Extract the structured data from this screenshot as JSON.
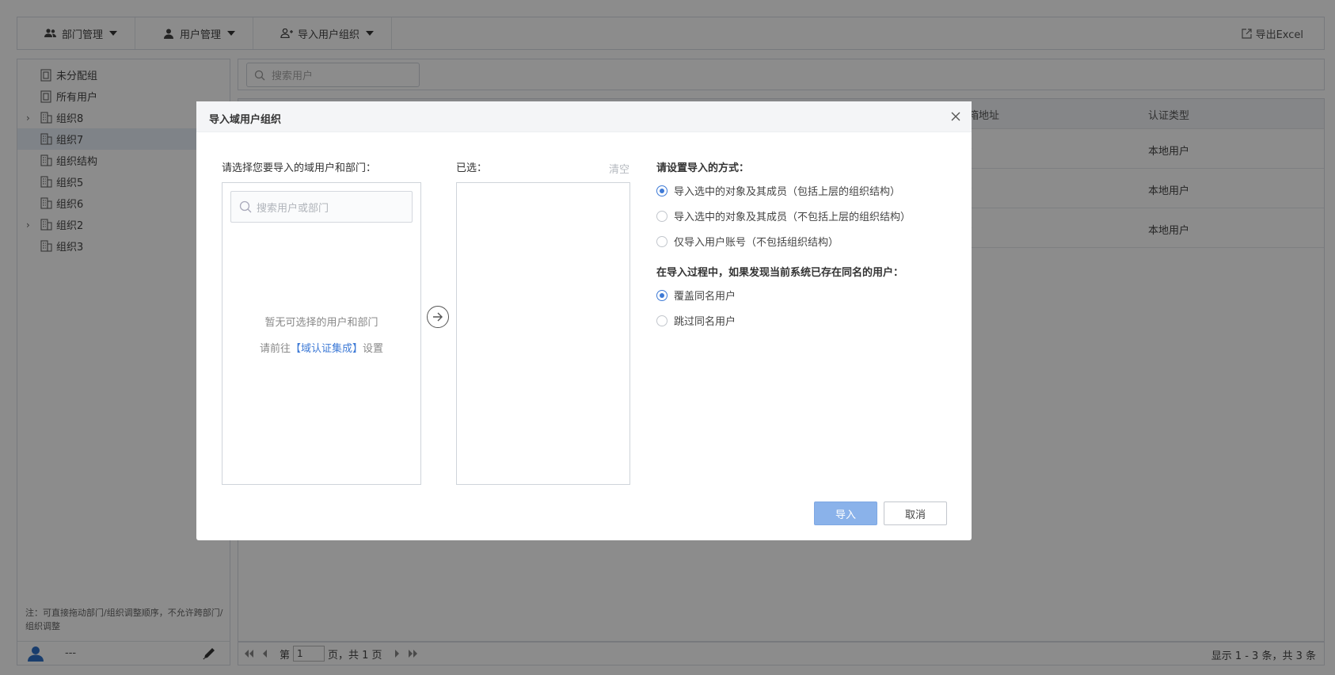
{
  "toolbar": {
    "dept_mgmt": "部门管理",
    "user_mgmt": "用户管理",
    "import_org": "导入用户组织",
    "export_excel": "导出Excel"
  },
  "tree": {
    "items": [
      {
        "label": "未分配组",
        "has_children": false,
        "icon": "doc-group-icon"
      },
      {
        "label": "所有用户",
        "has_children": false,
        "icon": "doc-group-icon"
      },
      {
        "label": "组织8",
        "has_children": true,
        "icon": "building-icon"
      },
      {
        "label": "组织7",
        "has_children": false,
        "icon": "building-icon",
        "active": true
      },
      {
        "label": "组织结构",
        "has_children": false,
        "icon": "building-icon"
      },
      {
        "label": "组织5",
        "has_children": false,
        "icon": "building-icon"
      },
      {
        "label": "组织6",
        "has_children": false,
        "icon": "building-icon"
      },
      {
        "label": "组织2",
        "has_children": true,
        "icon": "building-icon"
      },
      {
        "label": "组织3",
        "has_children": false,
        "icon": "building-icon"
      }
    ],
    "note": "注：可直接拖动部门/组织调整顺序，不允许跨部门/组织调整",
    "footer_user": "---"
  },
  "search": {
    "placeholder": "搜索用户"
  },
  "grid": {
    "columns": [
      "箱地址",
      "认证类型"
    ],
    "rows": [
      {
        "mail": "-",
        "auth": "本地用户"
      },
      {
        "mail": "-",
        "auth": "本地用户"
      },
      {
        "mail": "-",
        "auth": "本地用户"
      }
    ]
  },
  "pager": {
    "prefix": "第",
    "page": "1",
    "suffix": "页，共 1 页",
    "summary": "显示 1 - 3 条，共 3 条"
  },
  "dialog": {
    "title": "导入域用户组织",
    "choose_label": "请选择您要导入的域用户和部门：",
    "search_placeholder": "搜索用户或部门",
    "empty_text": "暂无可选择的用户和部门",
    "goto_prefix": "请前往",
    "goto_link": "【域认证集成】",
    "goto_suffix": "设置",
    "selected_label": "已选：",
    "clear_label": "清空",
    "mode_title": "请设置导入的方式：",
    "mode_options": [
      {
        "label": "导入选中的对象及其成员（包括上层的组织结构）",
        "checked": true
      },
      {
        "label": "导入选中的对象及其成员（不包括上层的组织结构）",
        "checked": false
      },
      {
        "label": "仅导入用户账号（不包括组织结构）",
        "checked": false
      }
    ],
    "dup_title": "在导入过程中，如果发现当前系统已存在同名的用户：",
    "dup_options": [
      {
        "label": "覆盖同名用户",
        "checked": true
      },
      {
        "label": "跳过同名用户",
        "checked": false
      }
    ],
    "import_btn": "导入",
    "cancel_btn": "取消"
  },
  "colors": {
    "accent": "#3e7ad6",
    "import_btn_bg": "#8ab2ea",
    "overlay": "rgba(0,0,0,0.45)"
  }
}
